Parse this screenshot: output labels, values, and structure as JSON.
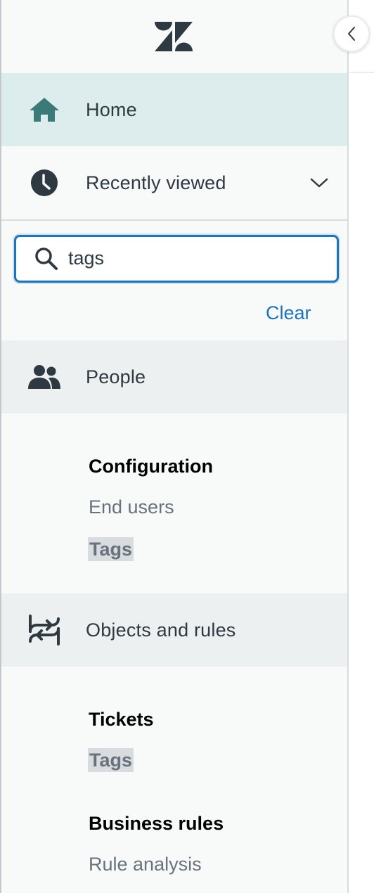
{
  "nav": {
    "home": {
      "label": "Home",
      "icon": "home-icon"
    },
    "recent": {
      "label": "Recently viewed",
      "icon": "clock-icon"
    }
  },
  "search": {
    "value": "tags",
    "placeholder": "",
    "clear_label": "Clear"
  },
  "results": {
    "people": {
      "label": "People",
      "icon": "people-icon",
      "sections": [
        {
          "heading": "Configuration",
          "links": [
            "End users",
            "Tags"
          ]
        }
      ]
    },
    "objects": {
      "label": "Objects and rules",
      "icon": "objects-rules-icon",
      "sections": [
        {
          "heading": "Tickets",
          "links": [
            "Tags"
          ]
        },
        {
          "heading": "Business rules",
          "links": [
            "Rule analysis"
          ]
        }
      ]
    }
  },
  "colors": {
    "accent": "#1f73b7",
    "home_active_bg": "#ddecec",
    "home_icon": "#3c7a7a",
    "icon_dark": "#2f3941",
    "highlight_bg": "#d8dcde"
  }
}
